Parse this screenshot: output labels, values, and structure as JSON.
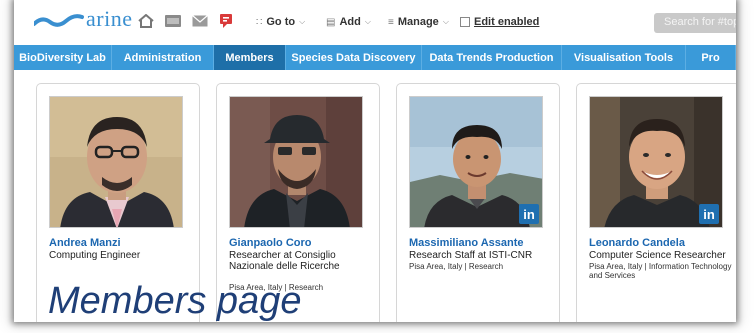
{
  "logo": {
    "text": "arine",
    "icon": "wave-logo-icon"
  },
  "toolbar": {
    "icons": [
      "home-icon",
      "dashboard-icon",
      "mail-icon",
      "notifications-icon"
    ],
    "goto_label": "Go to",
    "add_label": "Add",
    "manage_label": "Manage",
    "edit_label": "Edit enabled",
    "search_placeholder": "Search for #topic"
  },
  "nav": {
    "tabs": [
      {
        "label": "BioDiversity Lab",
        "active": false
      },
      {
        "label": "Administration",
        "active": false
      },
      {
        "label": "Members",
        "active": true
      },
      {
        "label": "Species Data Discovery",
        "active": false
      },
      {
        "label": "Data Trends Production",
        "active": false
      },
      {
        "label": "Visualisation Tools",
        "active": false
      },
      {
        "label": "Pro",
        "active": false
      }
    ]
  },
  "members": [
    {
      "name": "Andrea Manzi",
      "role": "Computing Engineer",
      "location": "",
      "linkedin": false
    },
    {
      "name": "Gianpaolo Coro",
      "role": "Researcher at Consiglio Nazionale delle Ricerche",
      "location": "Pisa Area, Italy | Research",
      "linkedin": false
    },
    {
      "name": "Massimiliano Assante",
      "role": "Research Staff at ISTI-CNR",
      "location": "Pisa Area, Italy | Research",
      "linkedin": true
    },
    {
      "name": "Leonardo Candela",
      "role": "Computer Science Researcher",
      "location": "Pisa Area, Italy | Information Technology and Services",
      "linkedin": true
    }
  ],
  "linkedin_badge": "in",
  "caption": "Members page",
  "colors": {
    "nav": "#3a9ad9",
    "nav_active": "#1e6fa8",
    "name": "#1c67b0",
    "caption": "#1f3f77",
    "linkedin": "#1f6fb0"
  }
}
